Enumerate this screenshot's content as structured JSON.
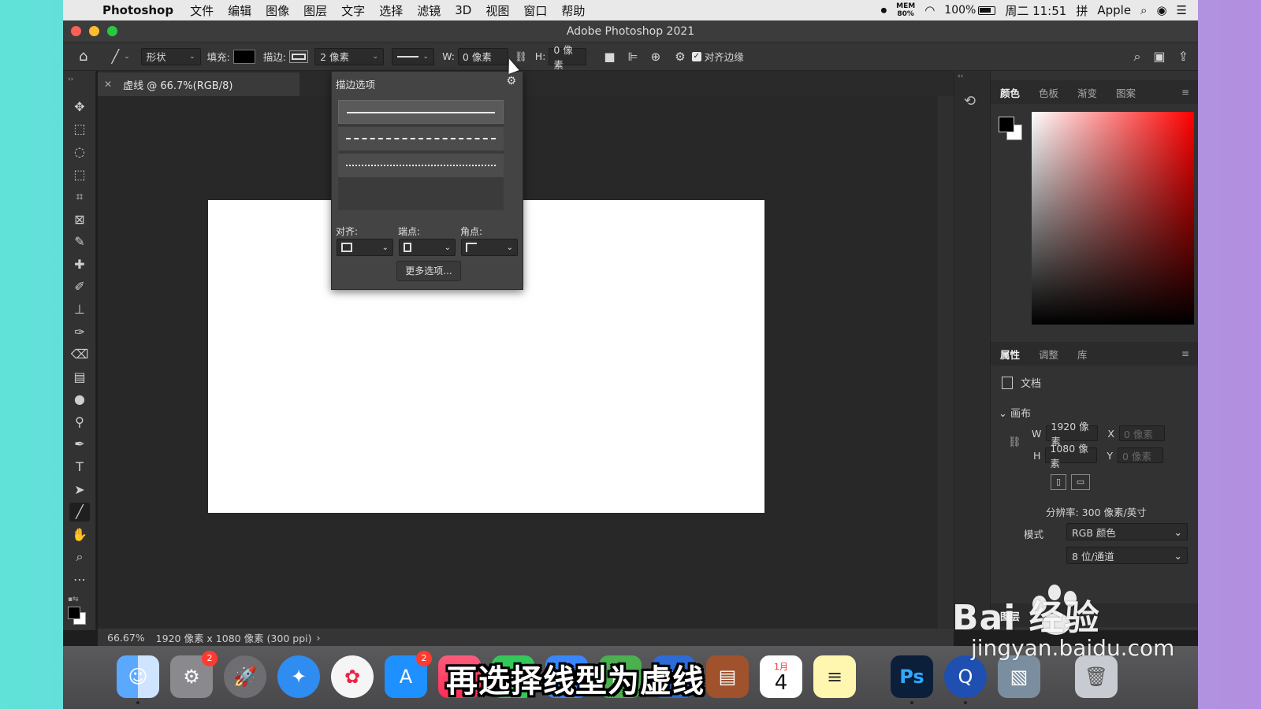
{
  "menubar": {
    "app_name": "Photoshop",
    "items": [
      "文件",
      "编辑",
      "图像",
      "图层",
      "文字",
      "选择",
      "滤镜",
      "3D",
      "视图",
      "窗口",
      "帮助"
    ],
    "mem_label": "MEM",
    "mem_value": "80%",
    "battery": "100%",
    "clock": "周二 11:51",
    "user": "Apple"
  },
  "window": {
    "title": "Adobe Photoshop 2021"
  },
  "options_bar": {
    "mode": "形状",
    "fill_label": "填充:",
    "stroke_label": "描边:",
    "stroke_width": "2 像素",
    "w_label": "W:",
    "w_value": "0 像素",
    "h_label": "H:",
    "h_value": "0 像素",
    "align_edges": "对齐边缘"
  },
  "document_tab": {
    "title": "虚线 @ 66.7%(RGB/8)"
  },
  "stroke_popup": {
    "title": "描边选项",
    "align_label": "对齐:",
    "caps_label": "端点:",
    "corners_label": "角点:",
    "more_button": "更多选项..."
  },
  "status_bar": {
    "zoom": "66.67%",
    "doc_info": "1920 像素 x 1080 像素 (300 ppi)"
  },
  "color_panel": {
    "tabs": [
      "颜色",
      "色板",
      "渐变",
      "图案"
    ]
  },
  "properties_panel": {
    "tabs": [
      "属性",
      "调整",
      "库"
    ],
    "doc_label": "文档",
    "canvas_label": "画布",
    "w_label": "W",
    "w_value": "1920 像素",
    "h_label": "H",
    "h_value": "1080 像素",
    "x_label": "X",
    "x_value": "0 像素",
    "y_label": "Y",
    "y_value": "0 像素",
    "resolution": "分辨率: 300 像素/英寸",
    "mode_label": "模式",
    "mode_value": "RGB 颜色",
    "depth_value": "8 位/通道"
  },
  "layers_panel": {
    "tabs": [
      "图层"
    ]
  },
  "dock": {
    "settings_badge": "2",
    "appstore_badge": "2",
    "calendar_month": "1月",
    "calendar_day": "4",
    "ps_label": "Ps"
  },
  "subtitle": "再选择线型为虚线",
  "watermark": {
    "brand": "Bai 经验",
    "url": "jingyan.baidu.com"
  }
}
